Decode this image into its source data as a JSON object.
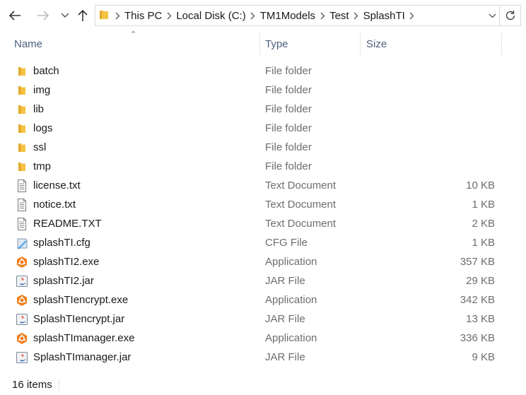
{
  "nav": {
    "back_icon": "arrow-left-icon",
    "forward_icon": "arrow-right-icon",
    "recent_icon": "chevron-down-icon",
    "up_icon": "arrow-up-icon"
  },
  "address": {
    "breadcrumbs": [
      "This PC",
      "Local Disk (C:)",
      "TM1Models",
      "Test",
      "SplashTI"
    ]
  },
  "columns": {
    "name": "Name",
    "type": "Type",
    "size": "Size"
  },
  "files": [
    {
      "name": "batch",
      "type": "File folder",
      "size": "",
      "icon": "folder-icon"
    },
    {
      "name": "img",
      "type": "File folder",
      "size": "",
      "icon": "folder-icon"
    },
    {
      "name": "lib",
      "type": "File folder",
      "size": "",
      "icon": "folder-icon"
    },
    {
      "name": "logs",
      "type": "File folder",
      "size": "",
      "icon": "folder-icon"
    },
    {
      "name": "ssl",
      "type": "File folder",
      "size": "",
      "icon": "folder-icon"
    },
    {
      "name": "tmp",
      "type": "File folder",
      "size": "",
      "icon": "folder-icon"
    },
    {
      "name": "license.txt",
      "type": "Text Document",
      "size": "10 KB",
      "icon": "text-file-icon"
    },
    {
      "name": "notice.txt",
      "type": "Text Document",
      "size": "1 KB",
      "icon": "text-file-icon"
    },
    {
      "name": "README.TXT",
      "type": "Text Document",
      "size": "2 KB",
      "icon": "text-file-icon"
    },
    {
      "name": "splashTI.cfg",
      "type": "CFG File",
      "size": "1 KB",
      "icon": "cfg-file-icon"
    },
    {
      "name": "splashTI2.exe",
      "type": "Application",
      "size": "357 KB",
      "icon": "app-icon"
    },
    {
      "name": "splashTI2.jar",
      "type": "JAR File",
      "size": "29 KB",
      "icon": "java-jar-icon"
    },
    {
      "name": "splashTIencrypt.exe",
      "type": "Application",
      "size": "342 KB",
      "icon": "app-icon"
    },
    {
      "name": "SplashTIencrypt.jar",
      "type": "JAR File",
      "size": "13 KB",
      "icon": "java-jar-icon"
    },
    {
      "name": "splashTImanager.exe",
      "type": "Application",
      "size": "336 KB",
      "icon": "app-icon"
    },
    {
      "name": "SplashTImanager.jar",
      "type": "JAR File",
      "size": "9 KB",
      "icon": "java-jar-icon"
    }
  ],
  "status": {
    "item_count": "16 items"
  },
  "colors": {
    "folder": "#f5c242",
    "header_text": "#4c607a",
    "type_text": "#6d6d6d",
    "app_orange": "#f07e1b"
  }
}
